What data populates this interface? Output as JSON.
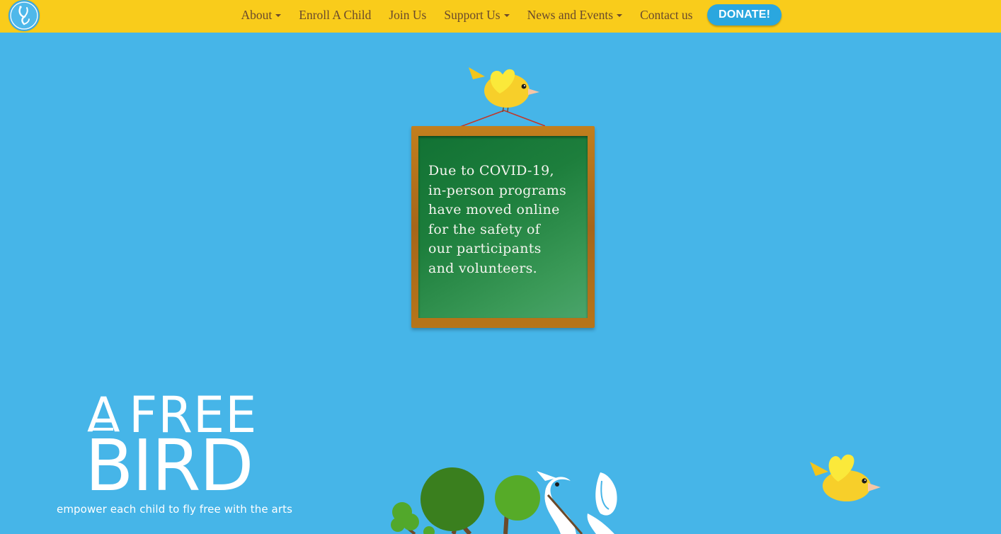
{
  "nav": {
    "logo_icon": "free-bird-logo-icon",
    "items": [
      {
        "label": "About",
        "has_dropdown": true
      },
      {
        "label": "Enroll A Child",
        "has_dropdown": false
      },
      {
        "label": "Join Us",
        "has_dropdown": false
      },
      {
        "label": "Support Us",
        "has_dropdown": true
      },
      {
        "label": "News and Events",
        "has_dropdown": true
      },
      {
        "label": "Contact us",
        "has_dropdown": false
      }
    ],
    "donate_label": "DONATE!"
  },
  "notice": {
    "text": "Due to COVID-19,\nin-person programs\nhave moved online\nfor the safety of\nour participants\nand volunteers."
  },
  "brand": {
    "a": "A",
    "free": "FREE",
    "bird": "BIRD",
    "tagline": "empower each child to fly free with the arts"
  },
  "colors": {
    "sky": "#46b5e8",
    "navbar": "#f9cc1b",
    "nav_text": "#6a4a2c",
    "donate": "#2aa7df",
    "chalkboard": "#1d7e3c",
    "frame": "#b77519",
    "bird": "#f7cf2a"
  }
}
